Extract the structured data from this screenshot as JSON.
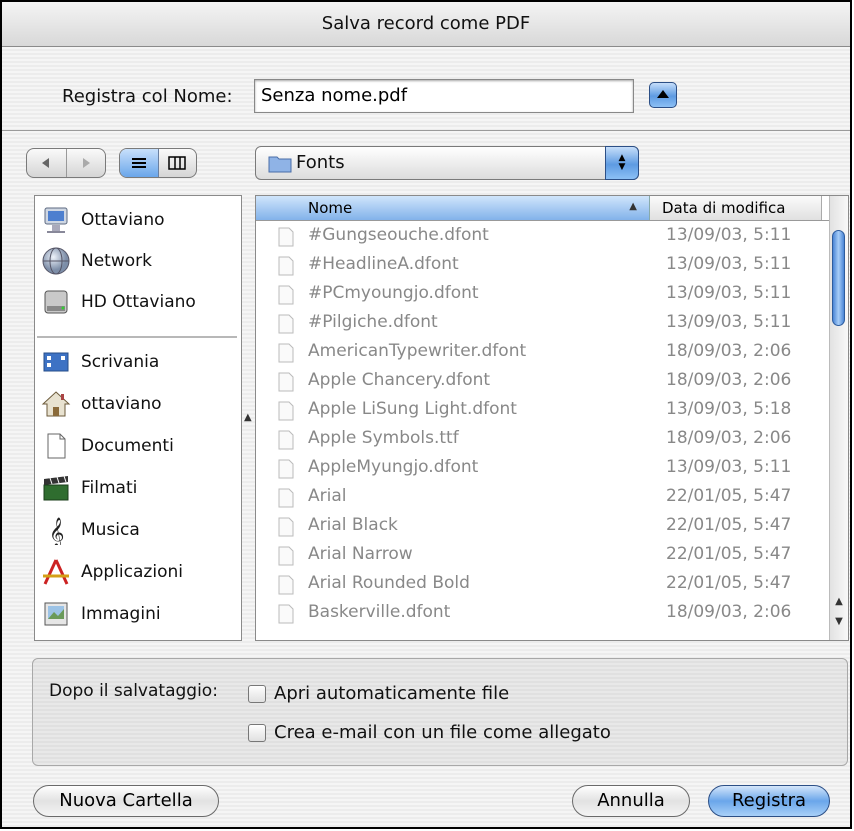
{
  "dialog": {
    "title": "Salva record come PDF"
  },
  "save_as": {
    "label": "Registra col Nome:",
    "value": "Senza nome.pdf"
  },
  "location": {
    "folder": "Fonts"
  },
  "sidebar": {
    "devices": [
      {
        "label": "Ottaviano",
        "icon": "computer-icon"
      },
      {
        "label": "Network",
        "icon": "network-globe-icon"
      },
      {
        "label": "HD Ottaviano",
        "icon": "hard-disk-icon"
      }
    ],
    "places": [
      {
        "label": "Scrivania",
        "icon": "desktop-icon"
      },
      {
        "label": "ottaviano",
        "icon": "home-icon"
      },
      {
        "label": "Documenti",
        "icon": "documents-icon"
      },
      {
        "label": "Filmati",
        "icon": "movies-clapper-icon"
      },
      {
        "label": "Musica",
        "icon": "music-clef-icon"
      },
      {
        "label": "Applicazioni",
        "icon": "applications-icon"
      },
      {
        "label": "Immagini",
        "icon": "pictures-icon"
      }
    ]
  },
  "file_list": {
    "columns": {
      "name": "Nome",
      "date": "Data di modifica"
    },
    "rows": [
      {
        "name": "#Gungseouche.dfont",
        "date": "13/09/03, 5:11"
      },
      {
        "name": "#HeadlineA.dfont",
        "date": "13/09/03, 5:11"
      },
      {
        "name": "#PCmyoungjo.dfont",
        "date": "13/09/03, 5:11"
      },
      {
        "name": "#Pilgiche.dfont",
        "date": "13/09/03, 5:11"
      },
      {
        "name": "AmericanTypewriter.dfont",
        "date": "18/09/03, 2:06"
      },
      {
        "name": "Apple Chancery.dfont",
        "date": "18/09/03, 2:06"
      },
      {
        "name": "Apple LiSung Light.dfont",
        "date": "13/09/03, 5:18"
      },
      {
        "name": "Apple Symbols.ttf",
        "date": "18/09/03, 2:06"
      },
      {
        "name": "AppleMyungjo.dfont",
        "date": "13/09/03, 5:11"
      },
      {
        "name": "Arial",
        "date": "22/01/05, 5:47"
      },
      {
        "name": "Arial Black",
        "date": "22/01/05, 5:47"
      },
      {
        "name": "Arial Narrow",
        "date": "22/01/05, 5:47"
      },
      {
        "name": "Arial Rounded Bold",
        "date": "22/01/05, 5:47"
      },
      {
        "name": "Baskerville.dfont",
        "date": "18/09/03, 2:06"
      }
    ]
  },
  "after_save": {
    "label": "Dopo il salvataggio:",
    "open_file": {
      "label": "Apri automaticamente file",
      "checked": false
    },
    "email": {
      "label": "Crea e-mail con un file come allegato",
      "checked": false
    }
  },
  "buttons": {
    "new_folder": "Nuova Cartella",
    "cancel": "Annulla",
    "save": "Registra"
  }
}
